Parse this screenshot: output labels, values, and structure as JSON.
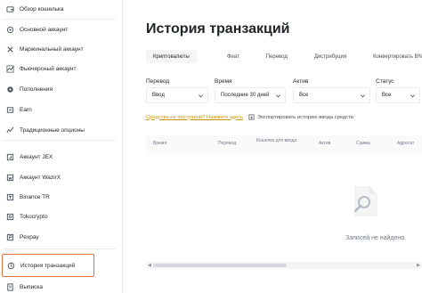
{
  "sidebar": {
    "items": [
      {
        "label": "Обзор кошелька",
        "icon": "wallet-overview-icon"
      },
      {
        "label": "Основной аккаунт",
        "icon": "spot-account-icon"
      },
      {
        "label": "Маржинальный аккаунт",
        "icon": "margin-account-icon"
      },
      {
        "label": "Фьючерсный аккаунт",
        "icon": "futures-account-icon"
      },
      {
        "label": "Пополнения",
        "icon": "deposits-icon"
      },
      {
        "label": "Earn",
        "icon": "earn-icon"
      },
      {
        "label": "Традиционные опционы",
        "icon": "options-icon"
      },
      {
        "label": "Аккаунт JEX",
        "icon": "jex-account-icon"
      },
      {
        "label": "Аккаунт WazirX",
        "icon": "wazirx-account-icon"
      },
      {
        "label": "Binance TR",
        "icon": "binance-tr-icon"
      },
      {
        "label": "Tokocrypto",
        "icon": "tokocrypto-icon"
      },
      {
        "label": "Pexpay",
        "icon": "pexpay-icon"
      },
      {
        "label": "История транзакций",
        "icon": "history-icon"
      },
      {
        "label": "Выписка",
        "icon": "statement-icon"
      }
    ]
  },
  "main": {
    "title": "История транзакций",
    "tabs": [
      {
        "label": "Криптовалюты"
      },
      {
        "label": "Фиат"
      },
      {
        "label": "Перевод"
      },
      {
        "label": "Дистрибуция"
      },
      {
        "label": "Конвертировать BNB"
      }
    ],
    "filters": {
      "transfer": {
        "label": "Перевод",
        "value": "Ввод"
      },
      "time": {
        "label": "Время",
        "value": "Последние 30 дней"
      },
      "asset": {
        "label": "Актив",
        "value": "Все"
      },
      "status": {
        "label": "Статус",
        "value": "Все"
      }
    },
    "links": {
      "not_arrived": "Средства не поступили? Нажмите здесь",
      "export": "Экспортировать историю ввода средств"
    },
    "table": {
      "columns": [
        "Время",
        "Перевод",
        "Кошелек для ввода",
        "Актив",
        "Сумма",
        "Адресат"
      ]
    },
    "empty_text": "Записей не найдено."
  },
  "colors": {
    "accent_link": "#c99400",
    "active_outline": "#e0703a"
  }
}
